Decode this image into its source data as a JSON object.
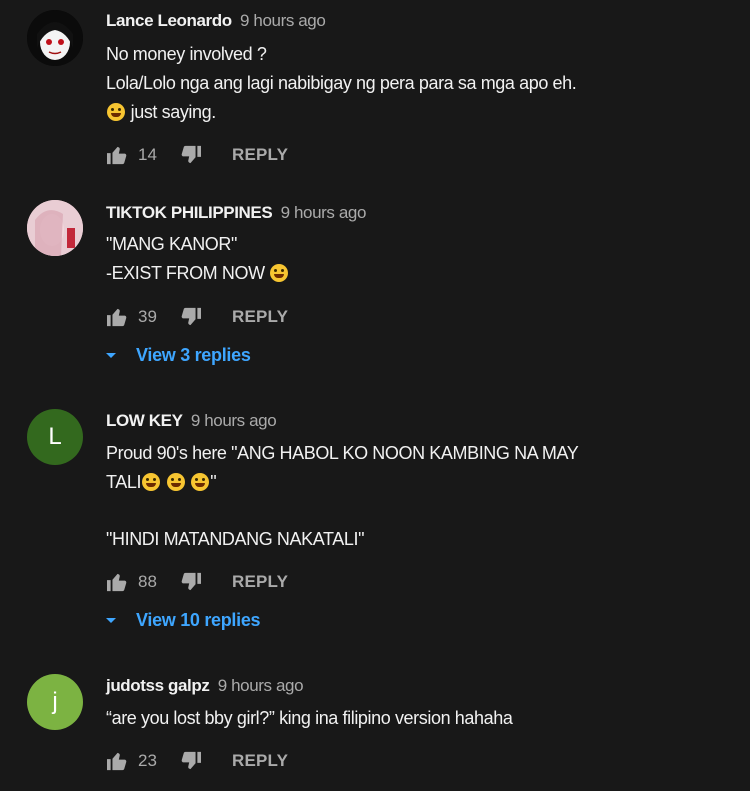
{
  "comments": [
    {
      "author": "Lance Leonardo",
      "time": "9 hours ago",
      "lines": [
        "No money involved ?",
        "Lola/Lolo nga ang lagi nabibigay ng pera para sa mga apo eh.",
        "just saying."
      ],
      "likes": "14",
      "reply_label": "REPLY"
    },
    {
      "author": "TIKTOK PHILIPPINES",
      "time": "9 hours ago",
      "lines": [
        "\"MANG KANOR\"",
        "-EXIST FROM NOW"
      ],
      "likes": "39",
      "reply_label": "REPLY",
      "view_replies": "View 3 replies"
    },
    {
      "author": "LOW KEY",
      "avatar_letter": "L",
      "time": "9 hours ago",
      "lines": [
        "Proud 90's here \"ANG HABOL KO NOON KAMBING NA MAY",
        "TALI",
        "\"",
        "\"HINDI MATANDANG NAKATALI\""
      ],
      "likes": "88",
      "reply_label": "REPLY",
      "view_replies": "View 10 replies"
    },
    {
      "author": "judotss galpz",
      "avatar_letter": "j",
      "time": "9 hours ago",
      "lines": [
        "“are you lost bby girl?” king ina filipino version hahaha"
      ],
      "likes": "23",
      "reply_label": "REPLY"
    }
  ],
  "icons": {
    "like": "thumbs-up-icon",
    "dislike": "thumbs-down-icon",
    "expand": "caret-down-icon",
    "emoji": "laughing-emoji-icon"
  },
  "colors": {
    "background": "#181818",
    "link": "#3ea6ff",
    "muted": "#aaaaaa"
  }
}
